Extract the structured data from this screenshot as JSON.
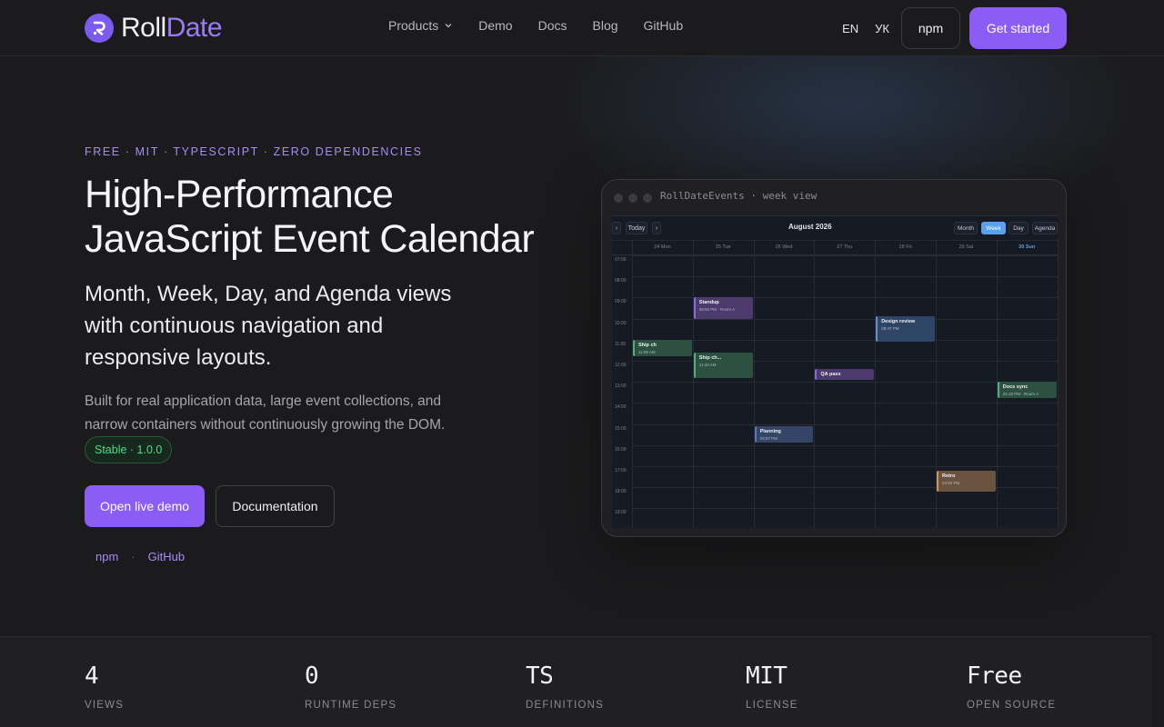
{
  "brand": {
    "name_a": "Roll",
    "name_b": "Date"
  },
  "nav": {
    "links": [
      "Products",
      "Demo",
      "Docs",
      "Blog",
      "GitHub"
    ],
    "lang_en": "EN",
    "lang_uk": "УК",
    "npm": "npm",
    "cta": "Get started"
  },
  "hero": {
    "eyebrow": "FREE · MIT · TYPESCRIPT · ZERO DEPENDENCIES",
    "title_line1": "High-Performance",
    "title_line2": "JavaScript Event Calendar",
    "subtitle": "Month, Week, Day, and Agenda views with continuous navigation and responsive layouts.",
    "body": "Built for real application data, large event collections, and narrow containers without continuously growing the DOM.",
    "badge": "Stable · 1.0.0",
    "primary_cta": "Open live demo",
    "secondary_cta": "Documentation",
    "mini_links": [
      "npm",
      "GitHub"
    ],
    "separator": "·"
  },
  "preview": {
    "window_title": "RollDateEvents · week view",
    "calendar": {
      "prev": "‹",
      "today": "Today",
      "next": "›",
      "title": "August 2026",
      "views": [
        "Month",
        "Week",
        "Day",
        "Agenda"
      ],
      "active_view": "Week",
      "days": [
        "24 Mon",
        "25 Tue",
        "26 Wed",
        "27 Thu",
        "28 Fri",
        "29 Sat",
        "30 Sun"
      ],
      "today_day": "30 Sun",
      "hours": [
        "07:00",
        "08:00",
        "09:00",
        "10:00",
        "11:00",
        "12:00",
        "13:00",
        "14:00",
        "15:00",
        "16:00",
        "17:00",
        "18:00",
        "19:00"
      ],
      "events": [
        {
          "title": "Standup",
          "sub": "08:50 PM · Room A",
          "day": 1,
          "start": 2.0,
          "dur": 1.0,
          "color": "purple"
        },
        {
          "title": "Design review",
          "sub": "09:47 PM",
          "day": 4,
          "start": 2.9,
          "dur": 1.2,
          "color": "blue"
        },
        {
          "title": "Ship ch",
          "sub": "11:05 AM",
          "day": 0,
          "start": 4.0,
          "dur": 0.8,
          "color": "green"
        },
        {
          "title": "Ship ch...",
          "sub": "11:40 AM",
          "day": 1,
          "start": 4.6,
          "dur": 1.2,
          "color": "green"
        },
        {
          "title": "QA pass",
          "sub": "",
          "day": 3,
          "start": 5.4,
          "dur": 0.5,
          "color": "purple"
        },
        {
          "title": "Docs sync",
          "sub": "01:15 PM · Room A",
          "day": 6,
          "start": 6.0,
          "dur": 0.75,
          "color": "green"
        },
        {
          "title": "Planning",
          "sub": "03:07 PM",
          "day": 2,
          "start": 8.1,
          "dur": 0.8,
          "color": "slate"
        },
        {
          "title": "Retro",
          "sub": "04:50 PM",
          "day": 5,
          "start": 10.2,
          "dur": 1.0,
          "color": "orange"
        }
      ]
    }
  },
  "stats": [
    {
      "value": "4",
      "label": "VIEWS"
    },
    {
      "value": "0",
      "label": "RUNTIME DEPS"
    },
    {
      "value": "TS",
      "label": "DEFINITIONS"
    },
    {
      "value": "MIT",
      "label": "LICENSE"
    },
    {
      "value": "Free",
      "label": "OPEN SOURCE"
    }
  ],
  "colors": {
    "accent": "#8b5cf6",
    "accent_text": "#a78bfa",
    "success": "#4ade80",
    "today": "#5aa0f0"
  }
}
